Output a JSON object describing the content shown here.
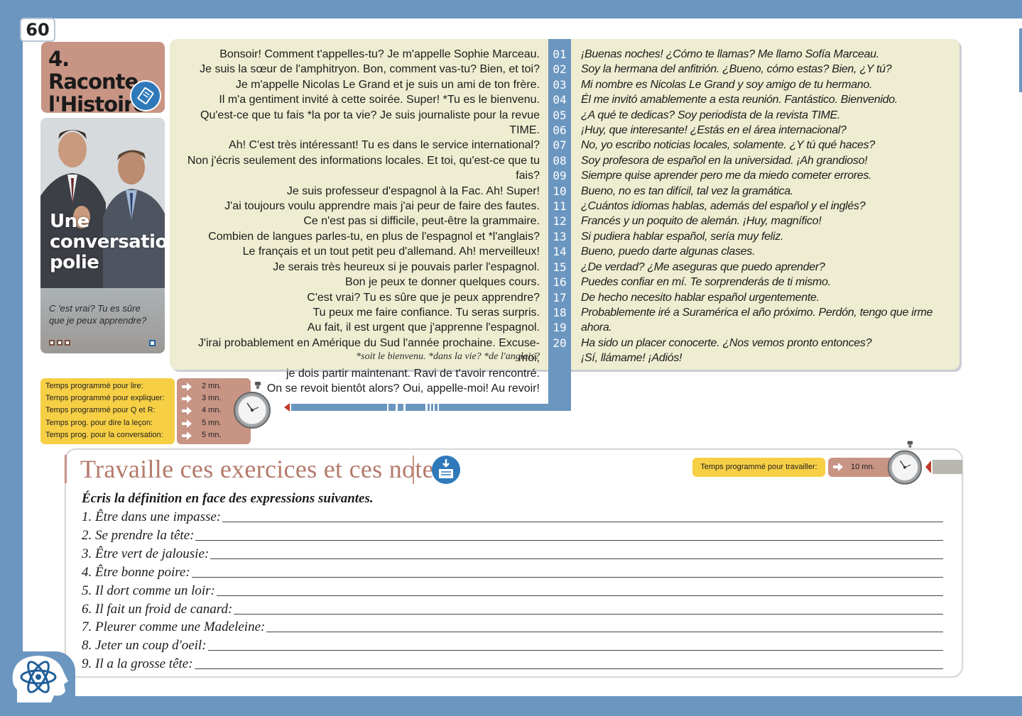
{
  "page_number": "60",
  "lesson": {
    "title_line1": "4. Raconte",
    "title_line2": "l'Histoire",
    "icon": "book-icon"
  },
  "photo": {
    "title_line1": "Une",
    "title_line2": "conversation",
    "title_line3": "polie",
    "caption_line1": "C 'est vrai? Tu es sûre",
    "caption_line2": "que je peux apprendre?"
  },
  "dialogue": {
    "french": [
      "Bonsoir! Comment t'appelles-tu? Je m'appelle Sophie Marceau.",
      "Je suis la sœur de l'amphitryon. Bon, comment vas-tu? Bien, et toi?",
      "Je m'appelle Nicolas Le Grand et je suis un ami de ton frère.",
      "Il m'a gentiment invité à cette soirée. Super! *Tu es le bienvenu.",
      "Qu'est-ce que tu fais *la por ta vie? Je suis journaliste pour la revue TIME.",
      "Ah! C'est très intéressant! Tu es dans le service international?",
      "Non j'écris seulement des informations locales. Et toi, qu'est-ce que tu fais?",
      "Je suis professeur d'espagnol à la Fac. Ah! Super!",
      "J'ai toujours voulu apprendre mais j'ai peur de faire des fautes.",
      "Ce n'est pas si difficile, peut-être la grammaire.",
      "Combien de langues parles-tu, en plus de l'espagnol et *l'anglais?",
      "Le français et un tout petit peu d'allemand. Ah! merveilleux!",
      "Je serais très heureux si je pouvais parler l'espagnol.",
      "Bon je peux te donner quelques cours.",
      "C'est vrai? Tu es sûre que je peux apprendre?",
      "Tu peux me faire confiance. Tu seras surpris.",
      "Au fait, il est urgent que j'apprenne l'espagnol.",
      "J'irai probablement en Amérique du Sud l'année prochaine. Excuse-moi,",
      "je dois partir maintenant. Ravi de t'avoir rencontré.",
      "On se revoit bientôt alors? Oui, appelle-moi!  Au revoir!"
    ],
    "note": "*soit le bienvenu.  *dans la vie?   *de l'anglais?",
    "numbers": [
      "01",
      "02",
      "03",
      "04",
      "05",
      "06",
      "07",
      "08",
      "09",
      "10",
      "11",
      "12",
      "13",
      "14",
      "15",
      "16",
      "17",
      "18",
      "19",
      "20"
    ],
    "spanish": [
      "¡Buenas noches! ¿Cómo te llamas? Me llamo Sofía Marceau.",
      "Soy la hermana del anfitrión. ¿Bueno, cómo estas? Bien, ¿Y tú?",
      "Mi nombre es Nicolas Le Grand y soy amigo de tu hermano.",
      "Él me invitó amablemente a esta reunión. Fantástico. Bienvenido.",
      "¿A qué te dedicas? Soy periodista de la revista TIME.",
      "¡Huy, que interesante! ¿Estás en el área internacional?",
      "No, yo escribo noticias locales, solamente. ¿Y tú qué haces?",
      "Soy profesora de español en la universidad. ¡Ah grandioso!",
      "Siempre quise aprender pero me da miedo cometer errores.",
      "Bueno, no es tan difícil, tal vez la gramática.",
      "¿Cuántos idiomas hablas, además del español y el inglés?",
      "Francés y un poquito de alemán. ¡Huy, magnífico!",
      "Si pudiera hablar español, sería muy feliz.",
      "Bueno, puedo darte algunas clases.",
      "¿De verdad? ¿Me aseguras que puedo aprender?",
      "Puedes confiar en mí. Te sorprenderás de ti mismo.",
      "De hecho necesito hablar español urgentemente.",
      "Probablemente iré a Suramérica el año próximo. Perdón, tengo que irme ahora.",
      "Ha sido un placer conocerte. ¿Nos vemos pronto entonces?",
      "¡Sí, llámame! ¡Adiós!"
    ]
  },
  "timing": {
    "labels": [
      "Temps programmé pour lire:",
      "Temps programmé pour expliquer:",
      "Temps programmé pour Q  et  R:",
      "Temps prog. pour dire la leçon:",
      "Temps prog. pour la conversation:"
    ],
    "values": [
      "2 mn.",
      "3 mn.",
      "4 mn.",
      "5 mn.",
      "5 mn."
    ]
  },
  "exercises": {
    "title": "Travaille ces exercices et ces notes",
    "timing_label": "Temps programmé pour travailler:",
    "timing_value": "10 mn.",
    "instruction": "Écris la définition en face des expressions suivantes.",
    "items": [
      "1. Être dans une impasse:",
      "2. Se prendre la tête:",
      "3. Être vert de jalousie:",
      "4. Être bonne poire:",
      "5. Il dort comme un loir:",
      "6. Il fait un froid de canard:",
      "7. Pleurer comme une Madeleine:",
      "8. Jeter un coup d'oeil:",
      "9. Il a la grosse tête:"
    ]
  },
  "colors": {
    "frame_blue": "#6b96c0",
    "panel_cream": "#eeedd1",
    "accent_rose": "#c89484",
    "label_yellow": "#f7cf45",
    "title_rose": "#b47a6b"
  }
}
